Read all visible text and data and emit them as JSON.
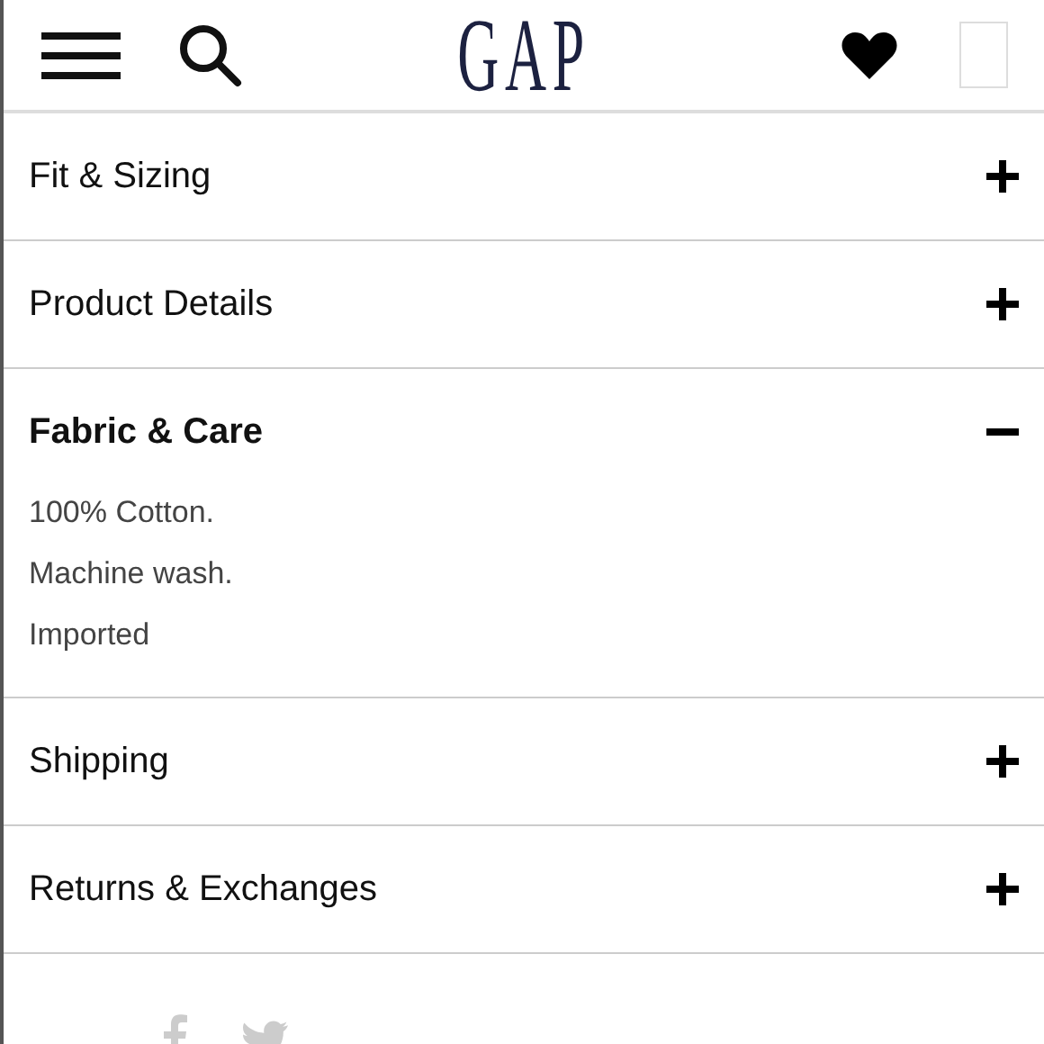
{
  "header": {
    "logo": "GAP"
  },
  "sections": [
    {
      "title": "Fit & Sizing",
      "expanded": false
    },
    {
      "title": "Product Details",
      "expanded": false
    },
    {
      "title": "Fabric & Care",
      "expanded": true,
      "lines": [
        "100% Cotton.",
        "Machine wash.",
        "Imported"
      ]
    },
    {
      "title": "Shipping",
      "expanded": false
    },
    {
      "title": "Returns & Exchanges",
      "expanded": false
    }
  ]
}
